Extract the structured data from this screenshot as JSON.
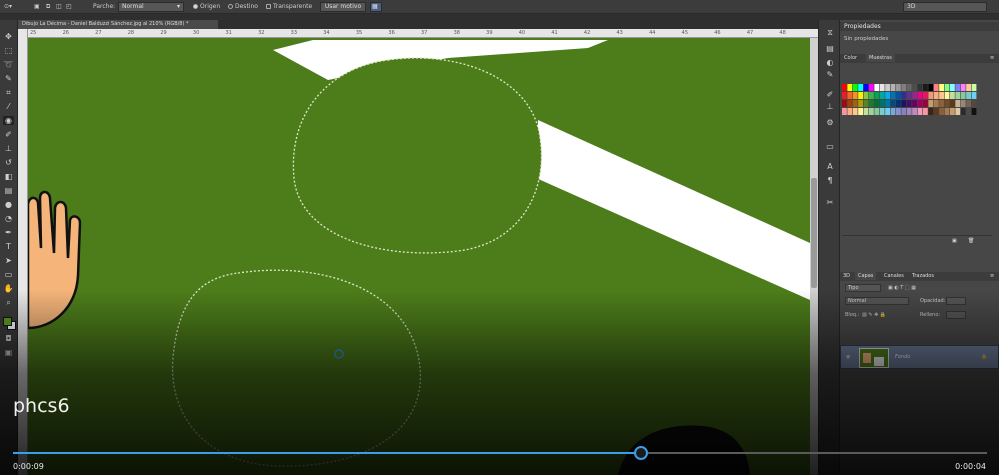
{
  "options_bar": {
    "patch_label": "Parche:",
    "patch_mode": "Normal",
    "origin_label": "Origen",
    "destination_label": "Destino",
    "transparent_label": "Transparente",
    "use_pattern_label": "Usar motivo",
    "workspace": "3D"
  },
  "document": {
    "tab_title": "Dibujo La Décima - Daniel Balduzzi Sánchez.jpg al 210% (RGB/8) *"
  },
  "ruler": {
    "top_ticks": [
      "25",
      "26",
      "27",
      "28",
      "29",
      "30",
      "31",
      "32",
      "33",
      "34",
      "35",
      "36",
      "37",
      "38",
      "39",
      "40",
      "41",
      "42",
      "43",
      "44",
      "45",
      "46",
      "47",
      "48"
    ]
  },
  "properties_panel": {
    "title": "Propiedades",
    "subtitle": "Sin propiedades"
  },
  "swatches_panel": {
    "tabs": [
      "Color",
      "Muestras"
    ]
  },
  "layers_panel": {
    "tabs": [
      "3D",
      "Capas",
      "Canales",
      "Trazados"
    ],
    "kind_filter": "Tipo",
    "blend_mode": "Normal",
    "opacity_label": "Opacidad:",
    "lock_label": "Bloq.:",
    "fill_label": "Relleno:",
    "layers": [
      {
        "name": "Fondo"
      }
    ]
  },
  "video": {
    "title": "phcs6",
    "current_time": "0:00:09",
    "remaining_time": "0:00:04",
    "progress": 0.645,
    "accent_color": "#3b9ee8"
  },
  "colors": {
    "grass": "#4d7d1a",
    "foreground_swatch": "#4d7d1a",
    "background_swatch": "#ffffff"
  }
}
